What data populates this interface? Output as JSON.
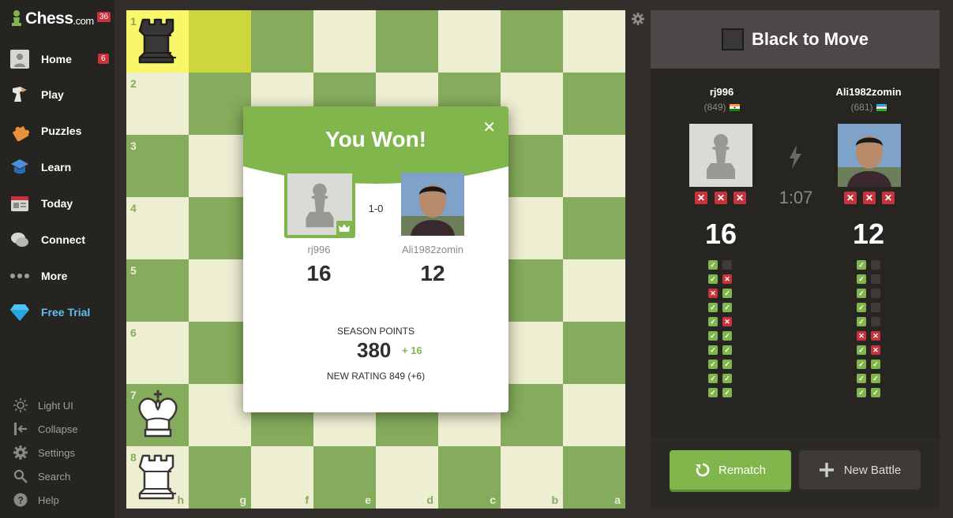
{
  "sidebar": {
    "logo": {
      "brand": "Chess",
      "suffix": ".com",
      "badge": "36"
    },
    "items": [
      {
        "label": "Home",
        "badge": "6",
        "icon": "home-avatar-icon"
      },
      {
        "label": "Play",
        "icon": "play-icon"
      },
      {
        "label": "Puzzles",
        "icon": "puzzle-icon"
      },
      {
        "label": "Learn",
        "icon": "learn-icon"
      },
      {
        "label": "Today",
        "icon": "today-icon"
      },
      {
        "label": "Connect",
        "icon": "connect-icon"
      },
      {
        "label": "More",
        "icon": "more-icon"
      },
      {
        "label": "Free Trial",
        "icon": "diamond-icon"
      }
    ],
    "bottom": [
      {
        "label": "Light UI",
        "icon": "sun-icon"
      },
      {
        "label": "Collapse",
        "icon": "collapse-icon"
      },
      {
        "label": "Settings",
        "icon": "settings-icon"
      },
      {
        "label": "Search",
        "icon": "search-icon"
      },
      {
        "label": "Help",
        "icon": "help-icon"
      }
    ]
  },
  "board": {
    "ranks": [
      "1",
      "2",
      "3",
      "4",
      "5",
      "6",
      "7",
      "8"
    ],
    "files": [
      "h",
      "g",
      "f",
      "e",
      "d",
      "c",
      "b",
      "a"
    ],
    "colors": {
      "light": "#eeeed2",
      "dark": "#85ab5c",
      "highlight_from": "#f7f769",
      "highlight_to": "#cdd63a"
    }
  },
  "panel": {
    "turn_text": "Black to Move",
    "timer": "1:07",
    "players": [
      {
        "name": "rj996",
        "rating": "(849)",
        "flag": "india",
        "score": "16",
        "marks": [
          [
            "c",
            "e"
          ],
          [
            "c",
            "x"
          ],
          [
            "x",
            "c"
          ],
          [
            "c",
            "c"
          ],
          [
            "c",
            "x"
          ],
          [
            "c",
            "c"
          ],
          [
            "c",
            "c"
          ],
          [
            "c",
            "c"
          ],
          [
            "c",
            "c"
          ],
          [
            "c",
            "c"
          ]
        ]
      },
      {
        "name": "Ali1982zomin",
        "rating": "(681)",
        "flag": "uzbekistan",
        "score": "12",
        "marks": [
          [
            "c",
            "e"
          ],
          [
            "c",
            "e"
          ],
          [
            "c",
            "e"
          ],
          [
            "c",
            "e"
          ],
          [
            "c",
            "e"
          ],
          [
            "x",
            "x"
          ],
          [
            "c",
            "x"
          ],
          [
            "c",
            "c"
          ],
          [
            "c",
            "c"
          ],
          [
            "c",
            "c"
          ]
        ]
      }
    ],
    "rematch_label": "Rematch",
    "new_battle_label": "New Battle"
  },
  "modal": {
    "title": "You Won!",
    "result": "1-0",
    "player1": {
      "name": "rj996",
      "score": "16"
    },
    "player2": {
      "name": "Ali1982zomin",
      "score": "12"
    },
    "season_label": "SEASON POINTS",
    "season_points": "380",
    "season_delta": "+ 16",
    "new_rating": "NEW RATING 849 (+6)"
  }
}
